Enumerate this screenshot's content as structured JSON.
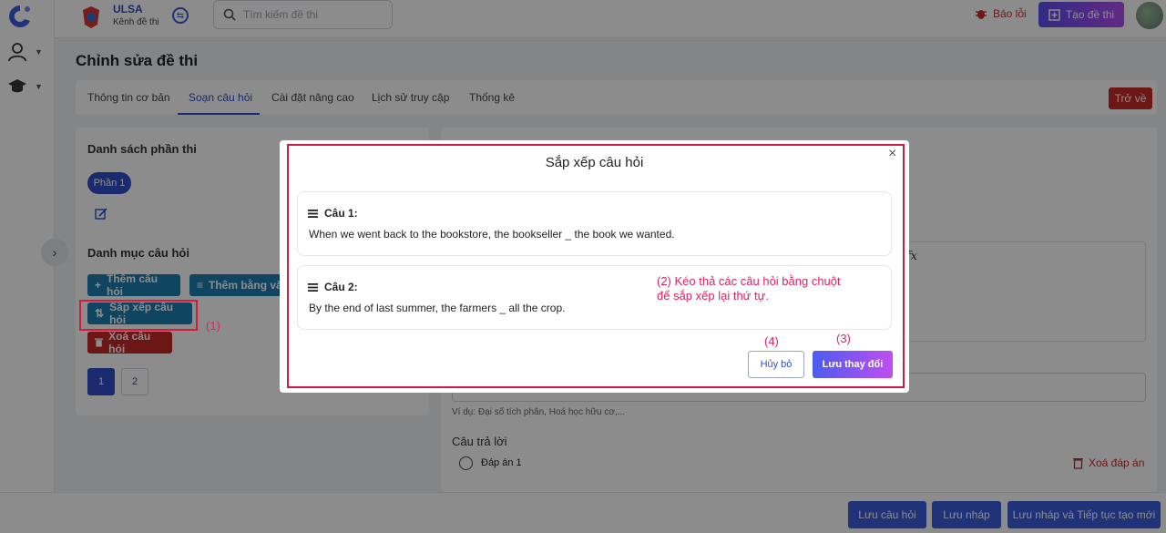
{
  "header": {
    "brand_name": "ULSA",
    "brand_sub": "Kênh đề thi",
    "search_placeholder": "Tìm kiếm đề thi",
    "report_label": "Báo lỗi",
    "create_label": "Tạo đề thi"
  },
  "page": {
    "title": "Chỉnh sửa đề thi",
    "tabs": [
      {
        "label": "Thông tin cơ bản"
      },
      {
        "label": "Soạn câu hỏi"
      },
      {
        "label": "Cài đặt nâng cao"
      },
      {
        "label": "Lịch sử truy cập"
      },
      {
        "label": "Thống kê"
      }
    ],
    "active_tab": "Soạn câu hỏi",
    "back_label": "Trở về"
  },
  "left_panel": {
    "sections_title": "Danh sách phần thi",
    "part_label": "Phần 1",
    "categories_title": "Danh mục câu hỏi",
    "add_question_label": "Thêm câu hỏi",
    "add_by_label": "Thêm bằng vă",
    "sort_label": "Sắp xếp câu hỏi",
    "delete_label": "Xoá câu hỏi",
    "pages": [
      "1",
      "2"
    ],
    "annotation": "(1)"
  },
  "right_panel": {
    "hint": "Ví dụ: Đại số tích phân, Hoá học hữu cơ,...",
    "answers_title": "Câu trả lời",
    "answer_1": "Đáp án 1",
    "delete_answer_label": "Xoá đáp án",
    "fx": "fx"
  },
  "footer": {
    "save_question": "Lưu câu hỏi",
    "save_draft": "Lưu nháp",
    "save_draft_continue": "Lưu nháp và Tiếp tục tạo mới"
  },
  "modal": {
    "title": "Sắp xếp câu hỏi",
    "close": "×",
    "questions": [
      {
        "head": "Câu 1:",
        "text": "When we went back to the bookstore, the bookseller _ the book we wanted."
      },
      {
        "head": "Câu 2:",
        "text": "By the end of last summer, the farmers _ all the crop."
      }
    ],
    "annotation_2_line1": "(2) Kéo thả các câu hỏi bằng chuột",
    "annotation_2_line2": "để sắp xếp lại thứ tự.",
    "annotation_3": "(3)",
    "annotation_4": "(4)",
    "cancel_label": "Hủy bỏ",
    "save_label": "Lưu thay đổi"
  },
  "colors": {
    "primary": "#2f4fc9",
    "danger": "#c62828",
    "annotation": "#e0245e",
    "teal_button": "#1e7fb3"
  }
}
